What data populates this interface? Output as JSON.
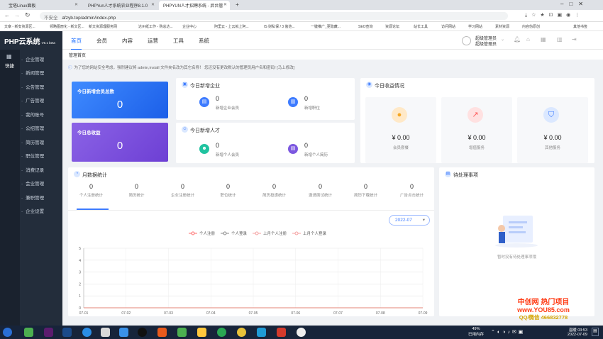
{
  "browser": {
    "tabs": [
      {
        "title": "宝塔Linux面板",
        "active": false
      },
      {
        "title": "PHPYun人才系统农业程序8.1.0",
        "active": false
      },
      {
        "title": "PHPYUN人才招聘系统 - 后台管",
        "active": true
      }
    ],
    "security": "不安全",
    "url": "afzyb.top/admin/index.php",
    "bookmarks": [
      "文章 - 新安资源区...",
      "领略图册化 - 新文区...",
      "新文资源理服务网",
      "达州纸工作 - 购总达...",
      "企业中心",
      "阿里云 - 上云就上阿...",
      "IS 财私保 / 3 装池...",
      "一键推广_更隐藏...",
      "SEO查询",
      "资源论坛",
      "站长工具",
      "访问网站",
      "学习网站",
      "素材资源",
      "内容伪原创",
      "其他书签"
    ]
  },
  "app": {
    "logo": "PHP云系统",
    "logo_sub": "V6.1 beta",
    "nav": [
      "首页",
      "会员",
      "内容",
      "运营",
      "工具",
      "系统"
    ],
    "user_name": "超级管理员",
    "user_role": "超级管理员",
    "quick_label": "快捷"
  },
  "sidebar": [
    "企业管理",
    "新闻管理",
    "公告管理",
    "广告管理",
    "我的账号",
    "公招管理",
    "简历管理",
    "职位管理",
    "消费记录",
    "会业管理",
    "兼职管理",
    "企业设置"
  ],
  "breadcrumb": "管理首页",
  "notice": "为了您的网站安全考虑，强烈建议将 admin,install 文件夹名改为其它名称！ 您还没有更改默认的管理员用户名和密码! [马上修改]",
  "boxes": {
    "members_title": "今日新增会员总数",
    "members_value": "0",
    "income_title": "今日总收益",
    "income_value": "0"
  },
  "companies": {
    "title": "今日新增企业",
    "items": [
      {
        "value": "0",
        "label": "新增企业会员"
      },
      {
        "value": "0",
        "label": "新增职位"
      }
    ]
  },
  "talents": {
    "title": "今日新增人才",
    "items": [
      {
        "value": "0",
        "label": "新增个人会员"
      },
      {
        "value": "0",
        "label": "新增个人简历"
      }
    ]
  },
  "income": {
    "title": "今日收益情况",
    "items": [
      {
        "value": "¥ 0.00",
        "label": "会员套餐"
      },
      {
        "value": "¥ 0.00",
        "label": "增值服务"
      },
      {
        "value": "¥ 0.00",
        "label": "其他服务"
      }
    ]
  },
  "monthly": {
    "title": "月数据统计",
    "stats": [
      {
        "value": "0",
        "label": "个人注册统计"
      },
      {
        "value": "0",
        "label": "简历统计"
      },
      {
        "value": "0",
        "label": "企业注册统计"
      },
      {
        "value": "0",
        "label": "职位统计"
      },
      {
        "value": "0",
        "label": "简历投递统计"
      },
      {
        "value": "0",
        "label": "邀请面试统计"
      },
      {
        "value": "0",
        "label": "简历下载统计"
      },
      {
        "value": "0",
        "label": "广告点击统计"
      }
    ],
    "month_select": "2022-07"
  },
  "chart_data": {
    "type": "line",
    "x": [
      "07-01",
      "07-02",
      "07-03",
      "07-04",
      "07-05",
      "07-06",
      "07-07",
      "07-08",
      "07-09"
    ],
    "ylim": [
      0,
      5
    ],
    "yticks": [
      "0",
      "1",
      "2",
      "3",
      "4",
      "5"
    ],
    "series": [
      {
        "name": "个人注册",
        "values": [
          0,
          0,
          0,
          0,
          0,
          0,
          0,
          0,
          0
        ]
      },
      {
        "name": "个人登录",
        "values": [
          0,
          0,
          0,
          0,
          0,
          0,
          0,
          0,
          0
        ]
      },
      {
        "name": "上月个人注册",
        "values": [
          0,
          0,
          0,
          0,
          0,
          0,
          0,
          0,
          0
        ]
      },
      {
        "name": "上月个人登录",
        "values": [
          0,
          0,
          0,
          0,
          0,
          0,
          0,
          0,
          0
        ]
      }
    ],
    "legend_position": "top",
    "grid": true,
    "colors": [
      "#ff6b6b",
      "#888888",
      "#f4a0a0",
      "#f4a0a0"
    ]
  },
  "todo": {
    "title": "待处理事项",
    "empty": "暂时没有待处理事项哦"
  },
  "watermark": {
    "line1": "中创网 热门项目",
    "line2": "www.YOU85.com",
    "line3": "QQ/微信 466832778"
  },
  "taskbar": {
    "temp": "49%",
    "temp_label": "已用内存",
    "time": "03:53",
    "date": "2022-07-09",
    "weather": "温暖"
  }
}
